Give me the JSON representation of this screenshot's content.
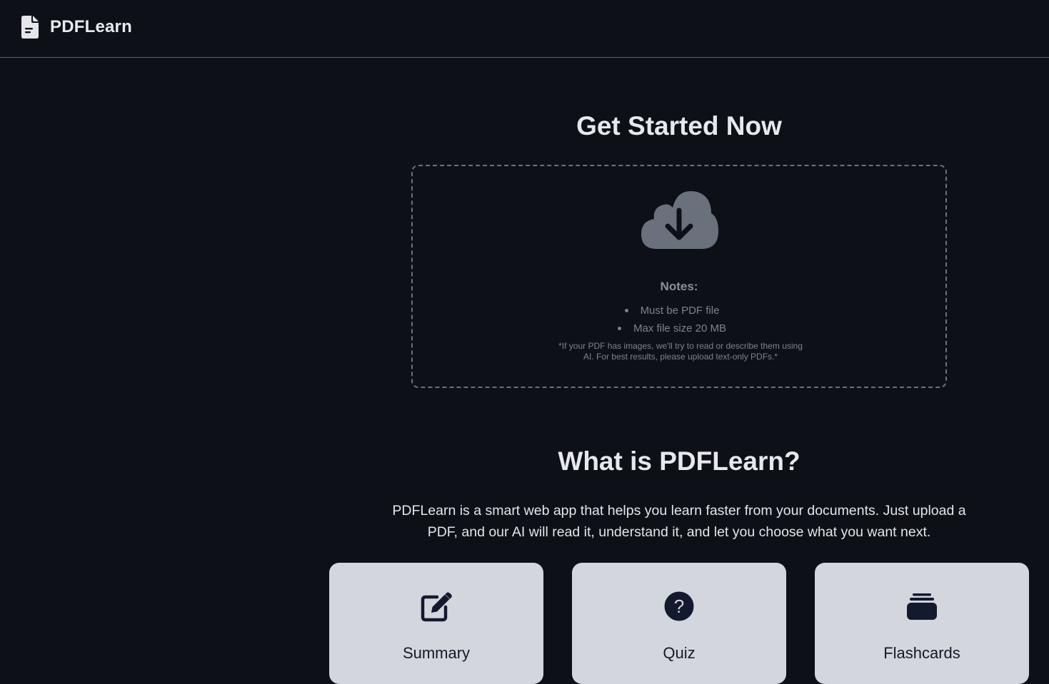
{
  "header": {
    "app_name": "PDFLearn",
    "logo_icon": "file-document-icon"
  },
  "upload": {
    "title": "Get Started Now",
    "icon": "cloud-download-icon",
    "notes_title": "Notes:",
    "notes": [
      "Must be PDF file",
      "Max file size 20 MB"
    ],
    "fineprint": "*If your PDF has images, we'll try to read or describe them using AI. For best results, please upload text-only PDFs.*"
  },
  "about": {
    "title": "What is PDFLearn?",
    "description": "PDFLearn is a smart web app that helps you learn faster from your documents. Just upload a PDF, and our AI will read it, understand it, and let you choose what you want next."
  },
  "features": [
    {
      "label": "Summary",
      "icon": "edit-pencil-icon"
    },
    {
      "label": "Quiz",
      "icon": "question-circle-icon"
    },
    {
      "label": "Flashcards",
      "icon": "card-stack-icon"
    }
  ],
  "colors": {
    "background": "#0d1117",
    "card": "#d3d6dd",
    "icon_dark": "#141a2e",
    "muted": "#7c828d"
  }
}
